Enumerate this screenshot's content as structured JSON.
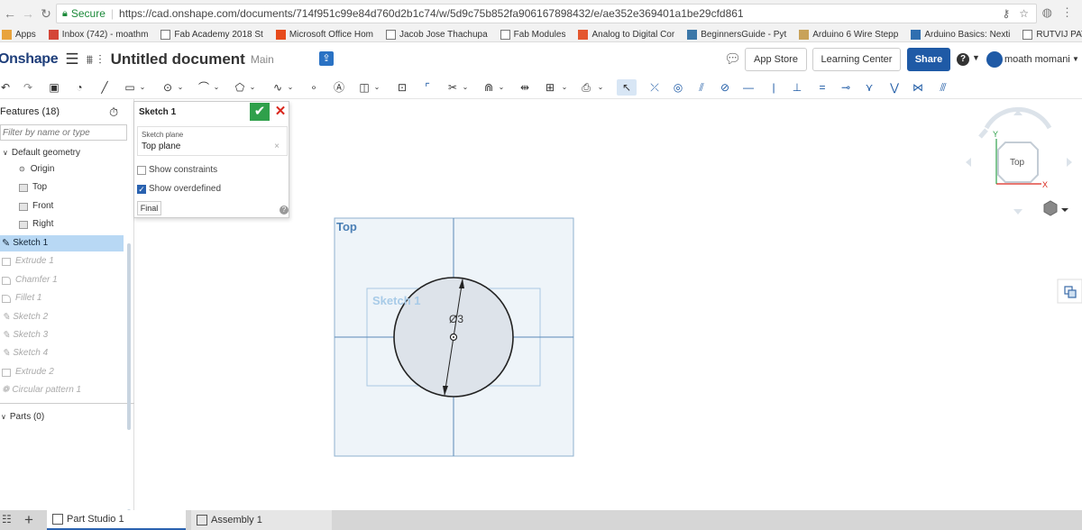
{
  "browser": {
    "secure_label": "Secure",
    "url": "https://cad.onshape.com/documents/714f951c99e84d760d2b1c74/w/5d9c75b852fa906167898432/e/ae352e369401a1be29cfd861"
  },
  "bookmarks": [
    {
      "label": "Apps",
      "icon": "apps-grid-icon"
    },
    {
      "label": "Inbox (742) - moathm",
      "icon": "gmail-icon"
    },
    {
      "label": "Fab Academy 2018 St",
      "icon": "page-icon"
    },
    {
      "label": "Microsoft Office Hom",
      "icon": "office-icon"
    },
    {
      "label": "Jacob Jose Thachupa",
      "icon": "page-icon"
    },
    {
      "label": "Fab Modules",
      "icon": "page-icon"
    },
    {
      "label": "Analog to Digital Cor",
      "icon": "arduino-icon"
    },
    {
      "label": "BeginnersGuide - Pyt",
      "icon": "python-icon"
    },
    {
      "label": "Arduino 6 Wire Stepp",
      "icon": "person-icon"
    },
    {
      "label": "Arduino Basics: Nexti",
      "icon": "blog-icon"
    },
    {
      "label": "RUTVIJ PATHAK",
      "icon": "page-icon"
    },
    {
      "label": "»",
      "icon": ""
    }
  ],
  "header": {
    "logo": "Onshape",
    "doc_title": "Untitled document",
    "branch": "Main",
    "app_store": "App Store",
    "learning_center": "Learning Center",
    "share": "Share",
    "help": "?",
    "user": "moath momani"
  },
  "features": {
    "title": "Features (18)",
    "filter_placeholder": "Filter by name or type",
    "default_geometry": "Default geometry",
    "items": [
      {
        "label": "Origin"
      },
      {
        "label": "Top"
      },
      {
        "label": "Front"
      },
      {
        "label": "Right"
      },
      {
        "label": "Sketch 1"
      },
      {
        "label": "Extrude 1"
      },
      {
        "label": "Chamfer 1"
      },
      {
        "label": "Fillet 1"
      },
      {
        "label": "Sketch 2"
      },
      {
        "label": "Sketch 3"
      },
      {
        "label": "Sketch 4"
      },
      {
        "label": "Extrude 2"
      },
      {
        "label": "Circular pattern 1"
      }
    ],
    "parts": "Parts (0)"
  },
  "sketch_dialog": {
    "title": "Sketch 1",
    "plane_label": "Sketch plane",
    "plane_value": "Top plane",
    "show_constraints": "Show constraints",
    "show_constraints_checked": false,
    "show_overdefined": "Show overdefined",
    "show_overdefined_checked": true,
    "final": "Final"
  },
  "viewport": {
    "plane_label": "Top",
    "sketch_label": "Sketch 1",
    "dimension": "Ø3",
    "view_cube_face": "Top",
    "axis_x": "X",
    "axis_y": "Y"
  },
  "tabs": {
    "part_studio": "Part Studio 1",
    "assembly": "Assembly 1"
  },
  "colors": {
    "brand_blue": "#1e3e7a",
    "share_blue": "#1f5aa6",
    "confirm_green": "#2fa04b",
    "cancel_red": "#d9261c",
    "selection": "#b8d8f4",
    "plane_fill": "#eef4f9",
    "plane_stroke": "#8fb0cf"
  }
}
